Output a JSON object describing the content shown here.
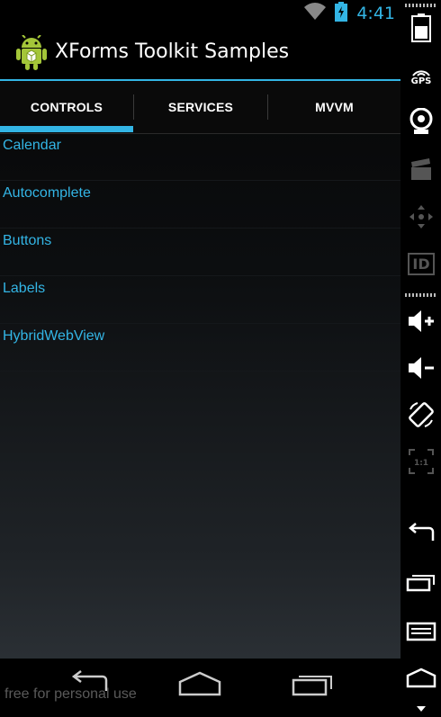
{
  "status_bar": {
    "time": "4:41",
    "icons": [
      "wifi-icon",
      "battery-charging-icon"
    ]
  },
  "action_bar": {
    "title": "XForms Toolkit Samples",
    "icon": "android-app-icon"
  },
  "tabs": [
    {
      "label": "CONTROLS",
      "selected": true
    },
    {
      "label": "SERVICES",
      "selected": false
    },
    {
      "label": "MVVM",
      "selected": false
    }
  ],
  "list_items": [
    "Calendar",
    "Autocomplete",
    "Buttons",
    "Labels",
    "HybridWebView"
  ],
  "nav_bar": {
    "buttons": [
      "back-icon",
      "home-icon",
      "recents-icon"
    ]
  },
  "watermark": "free for personal use",
  "side_panel": {
    "gps_label": "GPS",
    "id_label": "ID",
    "scale_label": "1:1",
    "buttons": [
      "battery-icon",
      "gps-icon",
      "camera-icon",
      "video-icon",
      "dpad-icon",
      "id-icon",
      "volume-up-icon",
      "volume-down-icon",
      "rotate-icon",
      "scale-icon",
      "back-icon",
      "recents-icon",
      "menu-icon",
      "home-icon"
    ]
  },
  "colors": {
    "accent": "#33b5e5",
    "title_text": "#ffffff",
    "background": "#000000"
  }
}
